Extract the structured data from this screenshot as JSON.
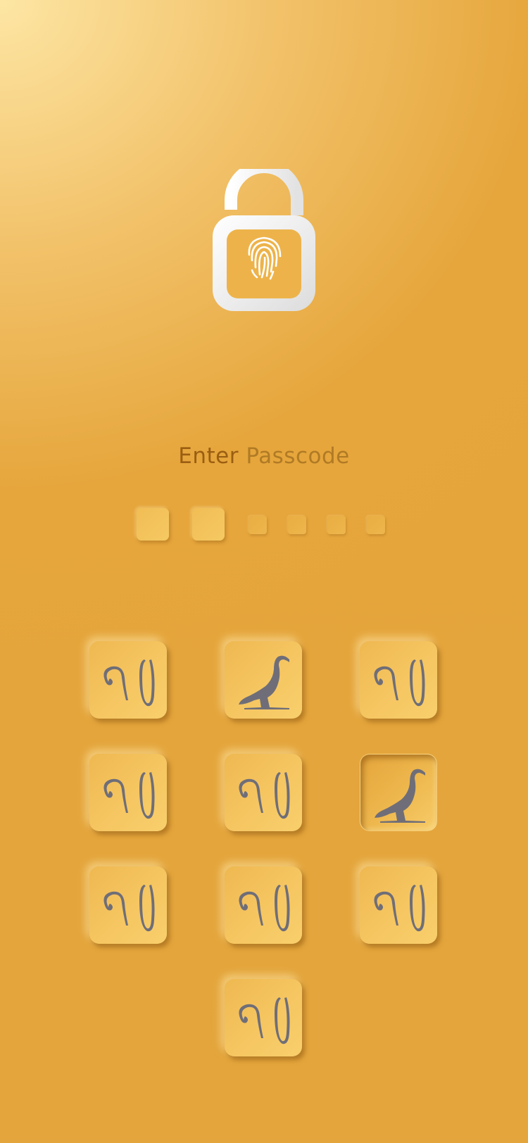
{
  "screen": {
    "title_word1": "Enter",
    "title_word2": "Passcode"
  },
  "lock": {
    "icon": "padlock-open-fingerprint-icon"
  },
  "passcode": {
    "length": 6,
    "entered": 2
  },
  "keypad": {
    "keys": [
      {
        "glyph": "hieroglyph-digit-icon",
        "state": "raised"
      },
      {
        "glyph": "ibis-bird-icon",
        "state": "raised"
      },
      {
        "glyph": "hieroglyph-digit-icon",
        "state": "raised"
      },
      {
        "glyph": "hieroglyph-digit-icon",
        "state": "raised"
      },
      {
        "glyph": "hieroglyph-digit-icon",
        "state": "raised"
      },
      {
        "glyph": "ibis-bird-icon",
        "state": "pressed"
      },
      {
        "glyph": "hieroglyph-digit-icon",
        "state": "raised"
      },
      {
        "glyph": "hieroglyph-digit-icon",
        "state": "raised"
      },
      {
        "glyph": "hieroglyph-digit-icon",
        "state": "raised"
      },
      {
        "glyph": "hieroglyph-digit-icon",
        "state": "raised"
      }
    ]
  },
  "colors": {
    "background": "#e5a53b",
    "background_highlight": "#fde6a4",
    "title": "#9a5e12",
    "glyph": "#6e6e78",
    "lock": "#f4f4f4"
  }
}
